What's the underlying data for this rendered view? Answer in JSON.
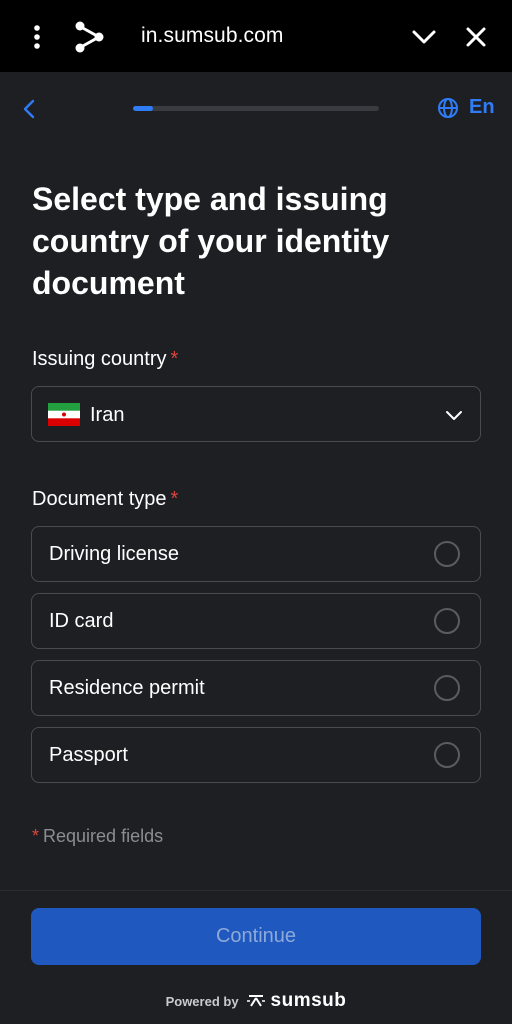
{
  "browser": {
    "url": "in.sumsub.com",
    "icons": [
      "more-vert-icon",
      "share-icon",
      "chevron-down-icon",
      "close-icon"
    ]
  },
  "header": {
    "progress": 0.08,
    "language": "En",
    "icons": [
      "back-arrow-icon",
      "globe-icon"
    ],
    "accent_color": "#2f7cf6"
  },
  "page": {
    "title": "Select type and issuing country of your identity document"
  },
  "country": {
    "label": "Issuing country",
    "required_mark": "*",
    "value": "Iran",
    "flag_icon": "iran-flag-icon"
  },
  "document_type": {
    "label": "Document type",
    "required_mark": "*",
    "options": [
      {
        "label": "Driving license",
        "selected": false
      },
      {
        "label": "ID card",
        "selected": false
      },
      {
        "label": "Residence permit",
        "selected": false
      },
      {
        "label": "Passport",
        "selected": false
      }
    ]
  },
  "footer": {
    "required_mark": "*",
    "required_note": "Required fields",
    "continue_label": "Continue",
    "powered_by": "Powered by",
    "brand": "sumsub",
    "button_color": "#1f58bf",
    "required_color": "#e0433d"
  }
}
